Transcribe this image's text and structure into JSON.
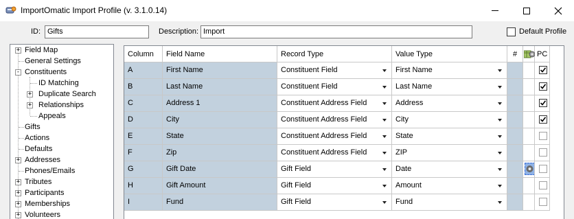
{
  "window": {
    "title": "ImportOmatic Import Profile (v. 3.1.0.14)"
  },
  "header": {
    "id_label": "ID:",
    "id_value": "Gifts",
    "description_label": "Description:",
    "description_value": "Import",
    "default_profile_label": "Default Profile",
    "default_profile_checked": false
  },
  "tree": {
    "items": [
      {
        "label": "Field Map",
        "expander": "+",
        "level": 0
      },
      {
        "label": "General Settings",
        "expander": "",
        "level": 0
      },
      {
        "label": "Constituents",
        "expander": "-",
        "level": 0
      },
      {
        "label": "ID Matching",
        "expander": "",
        "level": 1
      },
      {
        "label": "Duplicate Search",
        "expander": "+",
        "level": 1
      },
      {
        "label": "Relationships",
        "expander": "+",
        "level": 1
      },
      {
        "label": "Appeals",
        "expander": "",
        "level": 1
      },
      {
        "label": "Gifts",
        "expander": "",
        "level": 0
      },
      {
        "label": "Actions",
        "expander": "",
        "level": 0
      },
      {
        "label": "Defaults",
        "expander": "",
        "level": 0
      },
      {
        "label": "Addresses",
        "expander": "+",
        "level": 0
      },
      {
        "label": "Phones/Emails",
        "expander": "",
        "level": 0
      },
      {
        "label": "Tributes",
        "expander": "+",
        "level": 0
      },
      {
        "label": "Participants",
        "expander": "+",
        "level": 0
      },
      {
        "label": "Memberships",
        "expander": "+",
        "level": 0
      },
      {
        "label": "Volunteers",
        "expander": "+",
        "level": 0
      }
    ]
  },
  "grid": {
    "columns": {
      "column": "Column",
      "field_name": "Field Name",
      "record_type": "Record Type",
      "value_type": "Value Type",
      "hash": "#",
      "pc": "PC"
    },
    "rows": [
      {
        "column": "A",
        "field_name": "First Name",
        "record_type": "Constituent Field",
        "value_type": "First Name",
        "pc": true
      },
      {
        "column": "B",
        "field_name": "Last Name",
        "record_type": "Constituent Field",
        "value_type": "Last Name",
        "pc": true
      },
      {
        "column": "C",
        "field_name": "Address 1",
        "record_type": "Constituent Address Field",
        "value_type": "Address",
        "pc": true
      },
      {
        "column": "D",
        "field_name": "City",
        "record_type": "Constituent Address Field",
        "value_type": "City",
        "pc": true
      },
      {
        "column": "E",
        "field_name": "State",
        "record_type": "Constituent Address Field",
        "value_type": "State",
        "pc": false
      },
      {
        "column": "F",
        "field_name": "Zip",
        "record_type": "Constituent Address Field",
        "value_type": "ZIP",
        "pc": false
      },
      {
        "column": "G",
        "field_name": "Gift Date",
        "record_type": "Gift Field",
        "value_type": "Date",
        "pc": false,
        "gear_selected": true
      },
      {
        "column": "H",
        "field_name": "Gift Amount",
        "record_type": "Gift Field",
        "value_type": "Amount",
        "pc": false
      },
      {
        "column": "I",
        "field_name": "Fund",
        "record_type": "Gift Field",
        "value_type": "Fund",
        "pc": false
      }
    ]
  },
  "colors": {
    "readonly_cell": "#c2d1de",
    "grid_line": "#c8c8c8",
    "selection": "#8fb2e6"
  }
}
